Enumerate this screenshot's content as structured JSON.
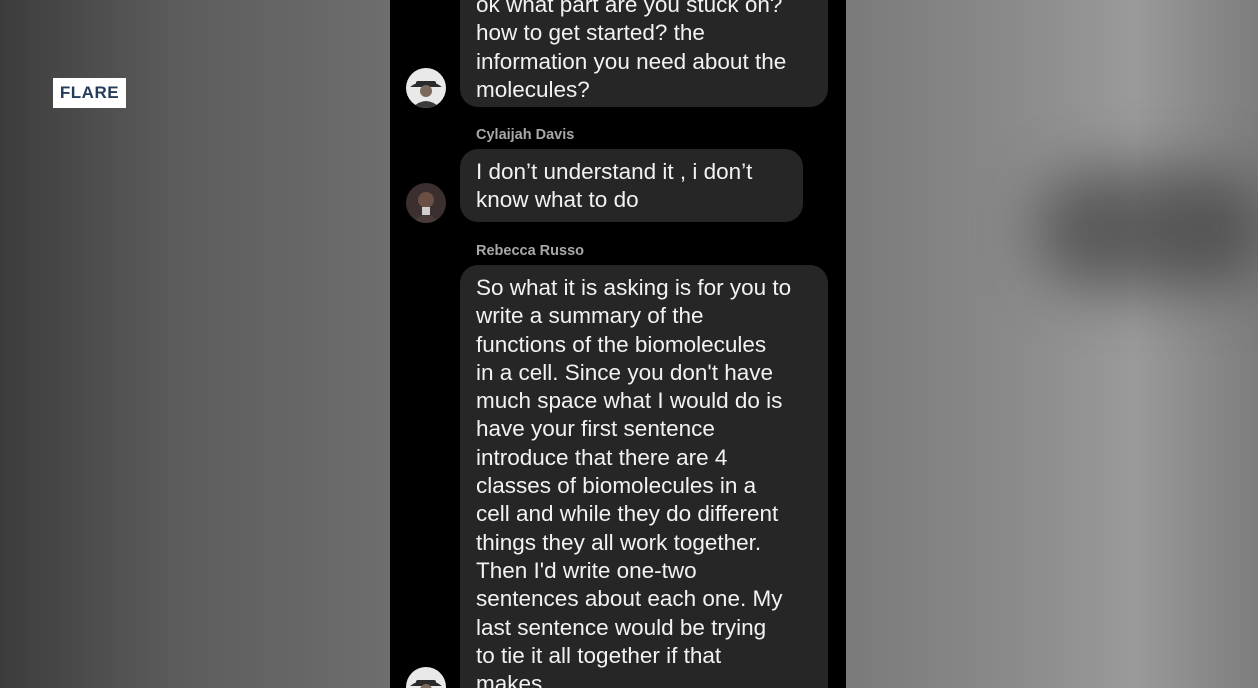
{
  "watermark": {
    "label": "FLARE"
  },
  "chat": {
    "messages": [
      {
        "sender": "",
        "text": "ok what part are you stuck on?\nhow to get started? the\ninformation you need about the\nmolecules?"
      },
      {
        "sender": "Cylaijah Davis",
        "text": "I don’t  understand it , i don’t\nknow what to do"
      },
      {
        "sender": "Rebecca Russo",
        "text": "So what it is asking is for you to\nwrite a summary of the\nfunctions of the biomolecules\nin a cell. Since you don't have\nmuch space what I would do is\nhave your first sentence\nintroduce that there are 4\nclasses of biomolecules in a\ncell and while they do different\nthings they all work together.\nThen I'd write one-two\nsentences about each one. My\nlast sentence would be trying\nto tie it all together if that\nmakes"
      }
    ]
  },
  "avatars": [
    {
      "name": "teacher-avatar-icon"
    },
    {
      "name": "student-avatar-icon"
    }
  ]
}
